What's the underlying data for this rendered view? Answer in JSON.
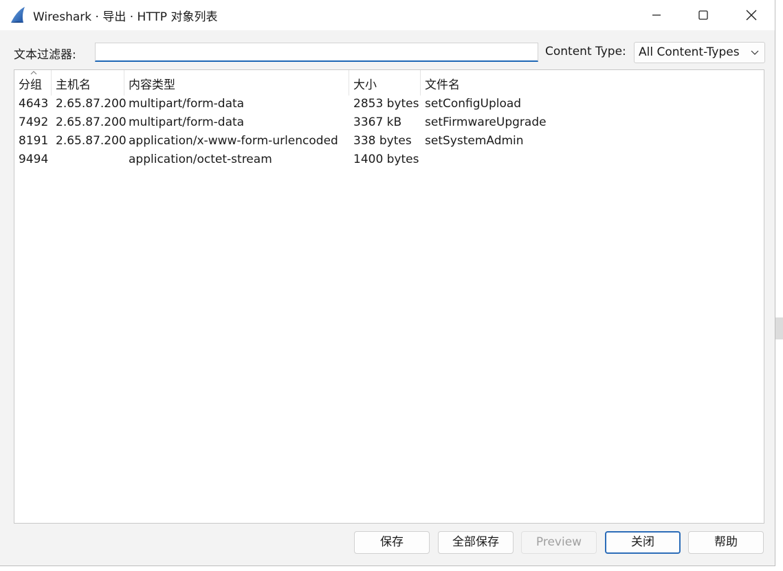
{
  "window": {
    "title": "Wireshark · 导出 · HTTP 对象列表"
  },
  "filter": {
    "label": "文本过滤器:",
    "value": "",
    "placeholder": ""
  },
  "content_type": {
    "label": "Content Type:",
    "selected": "All Content-Types"
  },
  "table": {
    "columns": [
      "分组",
      "主机名",
      "内容类型",
      "大小",
      "文件名"
    ],
    "rows": [
      {
        "packet": "4643",
        "host": "2.65.87.200",
        "content_type": "multipart/form-data",
        "size": "2853 bytes",
        "filename": "setConfigUpload"
      },
      {
        "packet": "7492",
        "host": "2.65.87.200",
        "content_type": "multipart/form-data",
        "size": "3367 kB",
        "filename": "setFirmwareUpgrade"
      },
      {
        "packet": "8191",
        "host": "2.65.87.200",
        "content_type": "application/x-www-form-urlencoded",
        "size": "338 bytes",
        "filename": "setSystemAdmin"
      },
      {
        "packet": "9494",
        "host": "",
        "content_type": "application/octet-stream",
        "size": "1400 bytes",
        "filename": ""
      }
    ]
  },
  "buttons": {
    "save": "保存",
    "save_all": "全部保存",
    "preview": "Preview",
    "close": "关闭",
    "help": "帮助"
  },
  "colors": {
    "accent": "#1d66b5",
    "default_button_border": "#2b6cb8",
    "disabled_text": "#a0a0a0"
  },
  "icons": {
    "app": "wireshark-fin-icon",
    "minimize": "minimize-icon",
    "maximize": "maximize-icon",
    "close": "close-icon",
    "dropdown": "chevron-down-icon",
    "sort": "sort-ascending-icon"
  }
}
